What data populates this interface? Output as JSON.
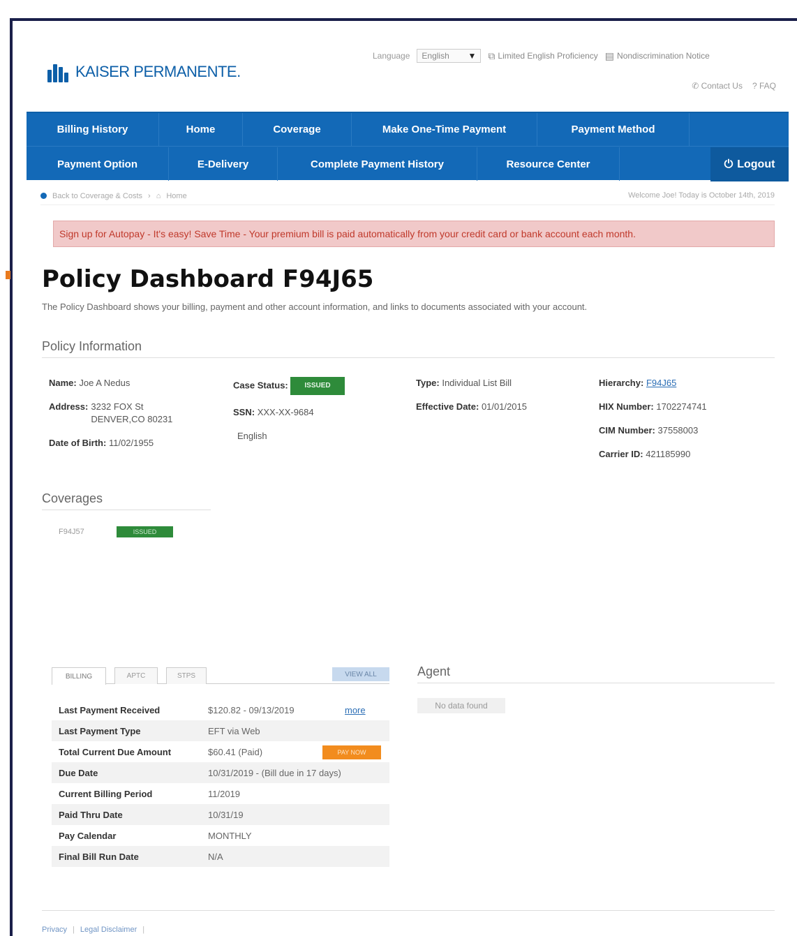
{
  "header": {
    "brand": "KAISER PERMANENTE.",
    "language_label": "Language",
    "language_value": "English",
    "limited_english": "Limited English Proficiency",
    "nondiscrimination": "Nondiscrimination Notice",
    "contact_us": "Contact Us",
    "faq": "FAQ"
  },
  "nav": {
    "row1": [
      "Billing History",
      "Home",
      "Coverage",
      "Make One-Time Payment",
      "Payment Method"
    ],
    "row2": [
      "Payment Option",
      "E-Delivery",
      "Complete Payment History",
      "Resource Center"
    ],
    "logout": "Logout"
  },
  "breadcrumb": {
    "back": "Back to Coverage & Costs",
    "home": "Home",
    "welcome": "Welcome Joe! Today is October 14th, 2019"
  },
  "alert": "Sign up for Autopay - It's easy! Save Time - Your premium bill is paid automatically from your credit card or bank account each month.",
  "page": {
    "title": "Policy Dashboard F94J65",
    "description": "The Policy Dashboard shows your billing, payment and other account information, and links to documents associated with your account."
  },
  "policy_info": {
    "heading": "Policy Information",
    "name_label": "Name:",
    "name": "Joe A Nedus",
    "address_label": "Address:",
    "address_line1": "3232 FOX St",
    "address_line2": "DENVER,CO 80231",
    "dob_label": "Date of Birth:",
    "dob": "11/02/1955",
    "case_status_label": "Case Status:",
    "case_status": "ISSUED",
    "ssn_label": "SSN:",
    "ssn": "XXX-XX-9684",
    "language": "English",
    "type_label": "Type:",
    "type": "Individual List Bill",
    "effective_label": "Effective Date:",
    "effective": "01/01/2015",
    "hierarchy_label": "Hierarchy:",
    "hierarchy": "F94J65",
    "hix_label": "HIX Number:",
    "hix": "1702274741",
    "cim_label": "CIM Number:",
    "cim": "37558003",
    "carrier_label": "Carrier ID:",
    "carrier": "421185990"
  },
  "coverages": {
    "heading": "Coverages",
    "id": "F94J57",
    "status": "ISSUED"
  },
  "tabs": [
    "BILLING",
    "APTC",
    "STPS"
  ],
  "view_all": "VIEW ALL",
  "billing": [
    {
      "label": "Last Payment Received",
      "value": "$120.82 - 09/13/2019"
    },
    {
      "label": "Last Payment Type",
      "value": "EFT via Web"
    },
    {
      "label": "Total Current Due Amount",
      "value": "$60.41 (Paid)"
    },
    {
      "label": "Due Date",
      "value": "10/31/2019 - (Bill due in 17 days)"
    },
    {
      "label": "Current Billing Period",
      "value": "11/2019"
    },
    {
      "label": "Paid Thru Date",
      "value": "10/31/19"
    },
    {
      "label": "Pay Calendar",
      "value": "MONTHLY"
    },
    {
      "label": "Final Bill Run Date",
      "value": "N/A"
    }
  ],
  "more": "more",
  "pay_now": "PAY NOW",
  "agent": {
    "heading": "Agent",
    "no_data": "No data found"
  },
  "footer": {
    "privacy": "Privacy",
    "legal": "Legal Disclaimer"
  },
  "colors": {
    "nav_blue": "#1369b7",
    "alert_bg": "#f1c9c9",
    "status_green": "#2e8b3a",
    "pay_orange": "#f28c1e"
  }
}
